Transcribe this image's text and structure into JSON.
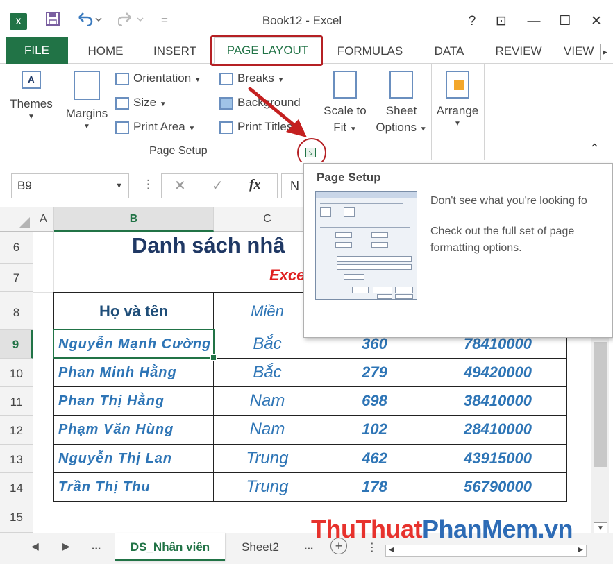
{
  "window": {
    "title": "Book12 - Excel",
    "app_logo": "X",
    "help": "?",
    "ribbon_display": "⊡",
    "minimize": "—",
    "maximize": "☐",
    "close": "✕"
  },
  "quick_access": {
    "save_icon": "save-icon",
    "undo_icon": "undo-icon",
    "redo_icon": "redo-icon",
    "customize": "="
  },
  "tabs": [
    "FILE",
    "HOME",
    "INSERT",
    "PAGE LAYOUT",
    "FORMULAS",
    "DATA",
    "REVIEW",
    "VIEW"
  ],
  "active_tab": "PAGE LAYOUT",
  "ribbon": {
    "themes": "Themes",
    "margins": "Margins",
    "orientation": "Orientation",
    "size": "Size",
    "print_area": "Print Area",
    "breaks": "Breaks",
    "background": "Background",
    "print_titles": "Print Titles",
    "scale_to": "Scale to",
    "fit": "Fit",
    "sheet": "Sheet",
    "options": "Options",
    "arrange": "Arrange",
    "group_label": "Page Setup"
  },
  "formula_bar": {
    "name_box": "B9",
    "fx": "fx",
    "value": "N"
  },
  "columns": [
    "A",
    "B",
    "C"
  ],
  "rows": [
    "6",
    "7",
    "8",
    "9",
    "10",
    "11",
    "12",
    "13",
    "14",
    "15"
  ],
  "sheet": {
    "title": "Danh sách nhâ",
    "subtitle": "Exce",
    "header_name": "Họ và tên",
    "header_region": "Miền",
    "records": [
      {
        "name": "Nguyễn  Mạnh Cường",
        "region": "Bắc",
        "value": "360",
        "salary": "78410000"
      },
      {
        "name": "Phan  Minh Hằng",
        "region": "Bắc",
        "value": "279",
        "salary": "49420000"
      },
      {
        "name": "Phan  Thị Hằng",
        "region": "Nam",
        "value": "698",
        "salary": "38410000"
      },
      {
        "name": "Phạm  Văn Hùng",
        "region": "Nam",
        "value": "102",
        "salary": "28410000"
      },
      {
        "name": "Nguyễn  Thị Lan",
        "region": "Trung",
        "value": "462",
        "salary": "43915000"
      },
      {
        "name": "Trần  Thị Thu",
        "region": "Trung",
        "value": "178",
        "salary": "56790000"
      }
    ]
  },
  "tooltip": {
    "title": "Page Setup",
    "line1": "Don't see what you're looking fo",
    "line2": "Check out the full set of page",
    "line3": "formatting options."
  },
  "sheet_tabs": {
    "prev": "◀",
    "next": "▶",
    "more_left": "...",
    "tab1": "DS_Nhân viên",
    "tab2": "Sheet2",
    "more_right": "...",
    "add": "+"
  },
  "watermark": {
    "part1": "ThuThuat",
    "part2": "PhanMem.vn"
  },
  "colors": {
    "excel_green": "#217346",
    "highlight_red": "#b52024",
    "title_blue": "#1f3864",
    "data_blue": "#2e75b6"
  }
}
